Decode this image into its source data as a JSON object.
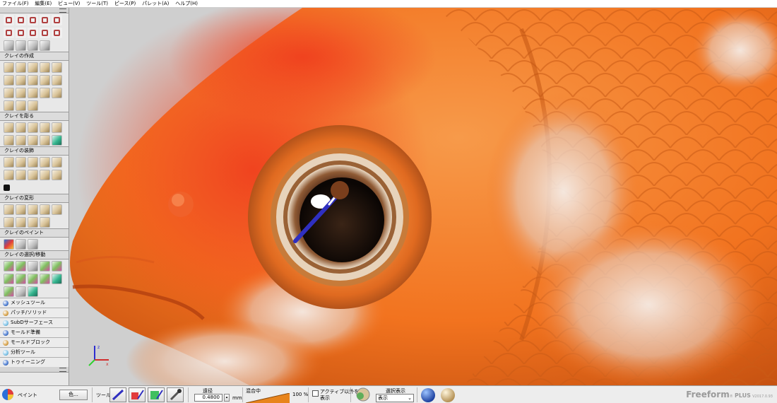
{
  "menu": [
    "ファイル(F)",
    "編集(E)",
    "ビュー(V)",
    "ツール(T)",
    "ピース(P)",
    "パレット(A)",
    "ヘルプ(H)"
  ],
  "palette": {
    "categories": [
      "クレイの作成",
      "クレイを彫る",
      "クレイの装飾",
      "クレイの変形",
      "クレイのペイント",
      "クレイの選択/移動"
    ],
    "toolbars": [
      "メッシュツール",
      "パッチ/ソリッド",
      "SubDサーフェース",
      "モールド準備",
      "モールドブロック",
      "分析ツール",
      "トゥイーニング"
    ]
  },
  "status": {
    "mode_label": "ペイント",
    "color_button": "色...",
    "tool_label": "ツール:",
    "thickness_label": "遠径",
    "thickness_value": "0.4800",
    "thickness_unit": "mm",
    "blend_label": "混合中",
    "blend_percent": "100 %",
    "checkbox_label_line1": "アクティブ以外を",
    "checkbox_label_line2": "表示",
    "selection_label": "選択表示",
    "selection_value": "表示",
    "brand_name": "Freeform",
    "brand_reg": "®",
    "brand_plus": "PLUS",
    "brand_version": "V2017.0.93"
  },
  "colors": {
    "fish_orange": "#f2731f",
    "fish_red": "#e8321a",
    "pupil": "#1a0e08",
    "tool_blue": "#2f2fc0",
    "background": "#cfcfcf"
  }
}
